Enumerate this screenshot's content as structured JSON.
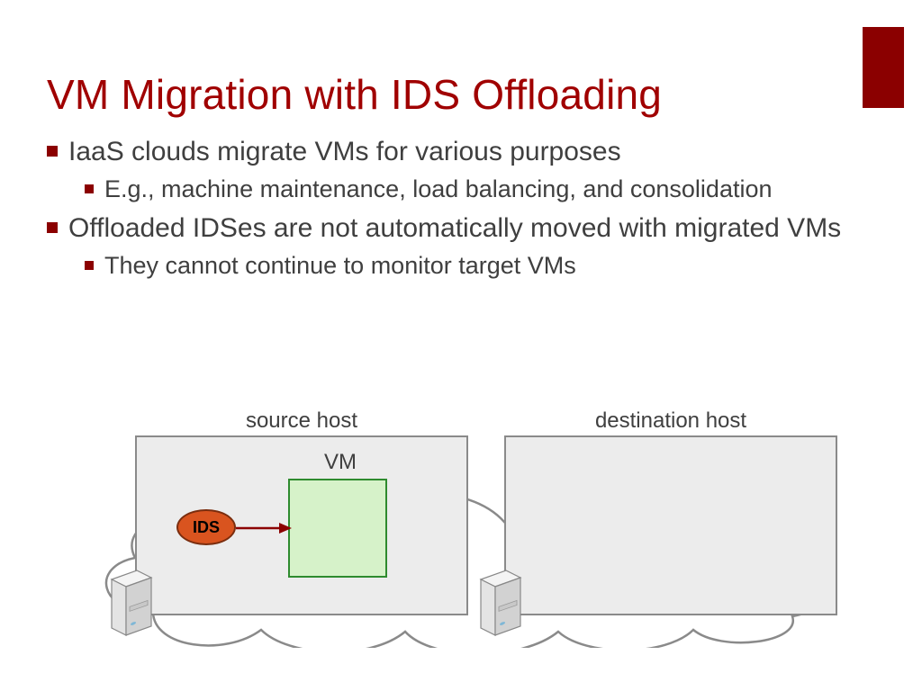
{
  "title": "VM Migration with IDS Offloading",
  "bullets": {
    "b1": "IaaS clouds migrate VMs for various purposes",
    "b1a": "E.g., machine maintenance, load balancing, and consolidation",
    "b2": "Offloaded IDSes are not automatically moved with migrated VMs",
    "b2a": "They cannot continue to monitor target VMs"
  },
  "diagram": {
    "source_label": "source host",
    "dest_label": "destination host",
    "vm_label": "VM",
    "ids_label": "IDS"
  },
  "colors": {
    "accent": "#8b0000",
    "title": "#a00000",
    "ids_fill": "#d9541f",
    "vm_fill": "#d6f2c9",
    "vm_border": "#2e8b2e"
  }
}
